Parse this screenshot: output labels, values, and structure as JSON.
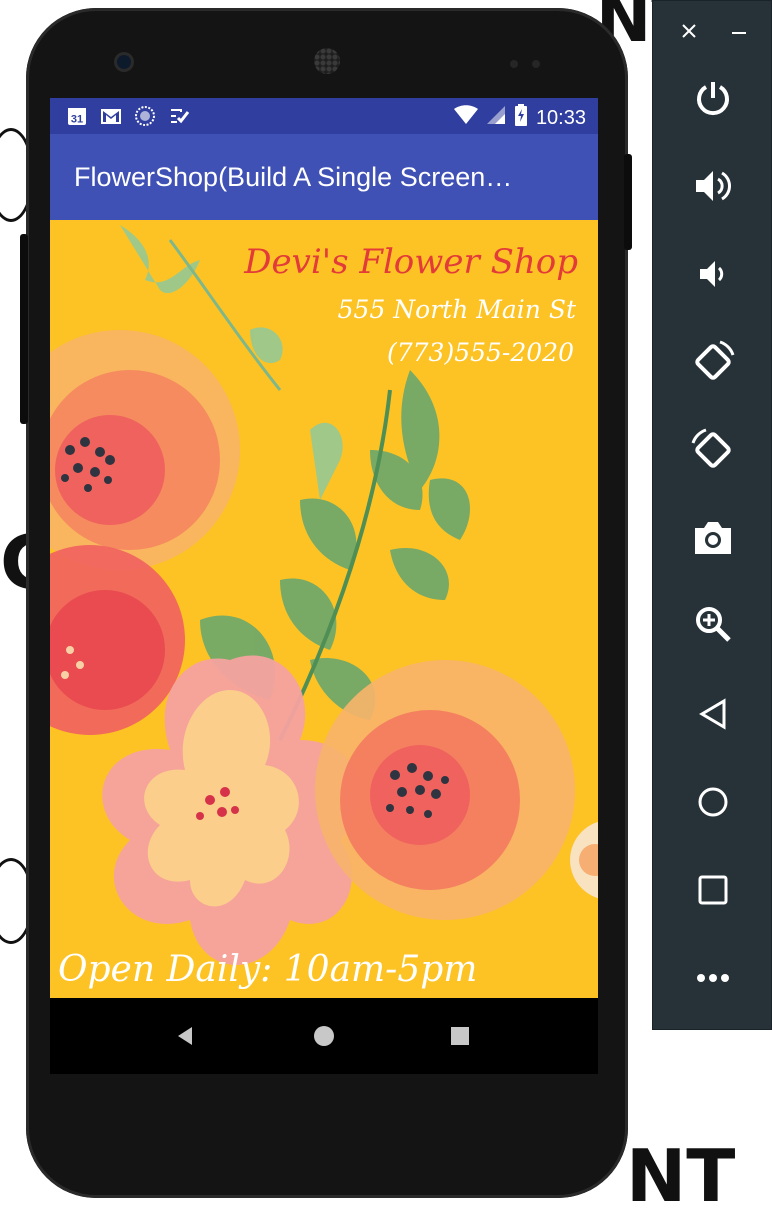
{
  "status_bar": {
    "calendar_day": "31",
    "time": "10:33",
    "left_icons": [
      "calendar-icon",
      "gmail-icon",
      "sync-icon",
      "task-icon"
    ],
    "right_icons": [
      "wifi-icon",
      "cellular-icon",
      "battery-charging-icon"
    ]
  },
  "app_bar": {
    "title": "FlowerShop(Build A Single Screen…"
  },
  "content": {
    "shop_name": "Devi's Flower Shop",
    "address": "555 North Main St",
    "phone": "(773)555-2020",
    "hours": "Open Daily: 10am-5pm",
    "background_color": "#fdc324"
  },
  "nav_bar": {
    "buttons": [
      "back-icon",
      "home-icon",
      "recents-icon"
    ]
  },
  "emulator_toolbar": {
    "close_symbol": "✕",
    "minimize_symbol": "—",
    "buttons": [
      "power-icon",
      "volume-up-icon",
      "volume-down-icon",
      "rotate-left-icon",
      "rotate-right-icon",
      "camera-icon",
      "zoom-icon",
      "back-icon",
      "home-icon",
      "overview-icon",
      "more-icon"
    ]
  },
  "colors": {
    "status_bar": "#303f9f",
    "app_bar": "#3f51b5",
    "shop_name": "#e23b39",
    "toolbar": "#263238"
  }
}
